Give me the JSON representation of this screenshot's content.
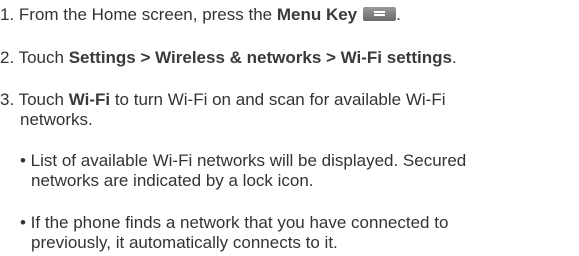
{
  "steps": [
    {
      "number": "1.",
      "prefix": " From the Home screen, press the ",
      "bold": "Menu Key",
      "suffix": "."
    },
    {
      "number": "2.",
      "prefix": " Touch ",
      "bold": "Settings > Wireless & networks > Wi-Fi settings",
      "suffix": "."
    },
    {
      "number": "3.",
      "prefix": " Touch ",
      "bold": "Wi-Fi",
      "suffix": " to turn Wi-Fi on and scan for available Wi-Fi",
      "continuation": "networks."
    }
  ],
  "bullets": [
    {
      "line1": "• List of available Wi-Fi networks will be displayed. Secured",
      "line2": "networks are indicated by a lock icon."
    },
    {
      "line1": "• If the phone finds a network that you have connected to",
      "line2": "previously, it automatically connects to it."
    }
  ],
  "menu_key_icon": "menu-key-icon"
}
